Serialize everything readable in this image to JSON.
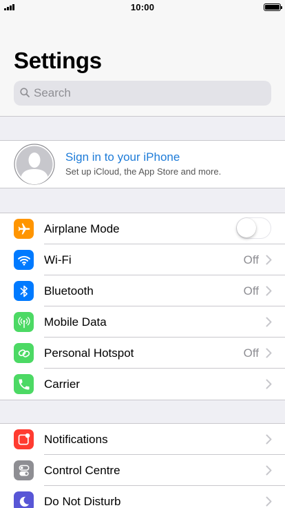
{
  "status_bar": {
    "time": "10:00"
  },
  "header": {
    "title": "Settings"
  },
  "search": {
    "placeholder": "Search"
  },
  "profile": {
    "title": "Sign in to your iPhone",
    "subtitle": "Set up iCloud, the App Store and more."
  },
  "colors": {
    "link": "#1d7bd8",
    "airplane": "#ff9500",
    "wifi": "#007aff",
    "bluetooth": "#007aff",
    "mobile_data": "#4cd964",
    "hotspot": "#4cd964",
    "carrier": "#4cd964",
    "notifications": "#ff3b30",
    "control_centre": "#8e8e93",
    "do_not_disturb": "#5856d6"
  },
  "group1": [
    {
      "label": "Airplane Mode",
      "icon": "airplane-icon",
      "toggle_on": false
    },
    {
      "label": "Wi-Fi",
      "icon": "wifi-icon",
      "value": "Off"
    },
    {
      "label": "Bluetooth",
      "icon": "bluetooth-icon",
      "value": "Off"
    },
    {
      "label": "Mobile Data",
      "icon": "mobile-data-icon"
    },
    {
      "label": "Personal Hotspot",
      "icon": "hotspot-icon",
      "value": "Off"
    },
    {
      "label": "Carrier",
      "icon": "phone-icon"
    }
  ],
  "group2": [
    {
      "label": "Notifications",
      "icon": "notifications-icon"
    },
    {
      "label": "Control Centre",
      "icon": "control-centre-icon"
    },
    {
      "label": "Do Not Disturb",
      "icon": "moon-icon"
    }
  ]
}
